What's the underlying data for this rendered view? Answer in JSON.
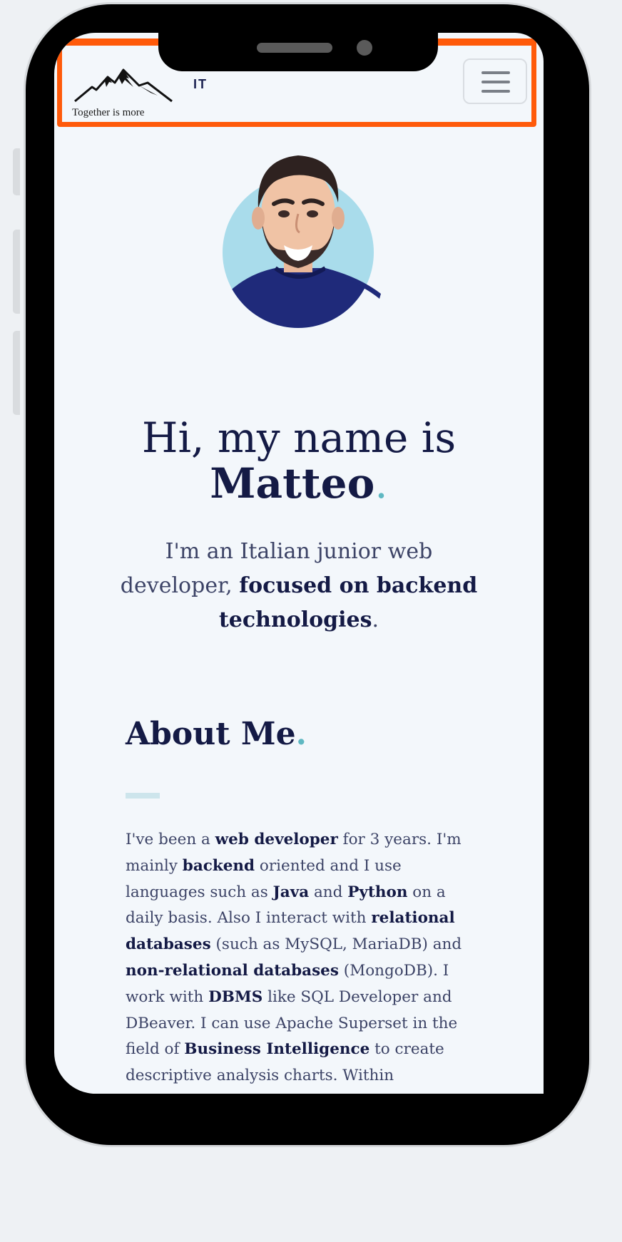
{
  "navbar": {
    "logo_tagline": "Together is more",
    "brand_suffix": "IT",
    "menu_icon": "hamburger-icon",
    "highlight_color": "#ff5a0a"
  },
  "hero": {
    "greeting": "Hi, my name is",
    "name": "Matteo",
    "period": ".",
    "subtitle_part1": "I'm an Italian junior web developer, ",
    "subtitle_bold": "focused on backend technologies",
    "subtitle_end": "."
  },
  "about": {
    "title": "About Me",
    "period": ".",
    "paragraph": [
      {
        "t": "I've been a ",
        "b": false
      },
      {
        "t": "web developer",
        "b": true
      },
      {
        "t": " for 3 years. I'm mainly ",
        "b": false
      },
      {
        "t": "backend",
        "b": true
      },
      {
        "t": " oriented and I use languages such as ",
        "b": false
      },
      {
        "t": "Java",
        "b": true
      },
      {
        "t": " and ",
        "b": false
      },
      {
        "t": "Python",
        "b": true
      },
      {
        "t": " on a daily basis. Also I interact with ",
        "b": false
      },
      {
        "t": "relational databases",
        "b": true
      },
      {
        "t": " (such as MySQL, MariaDB) and ",
        "b": false
      },
      {
        "t": "non-relational databases",
        "b": true
      },
      {
        "t": " (MongoDB). I work with ",
        "b": false
      },
      {
        "t": "DBMS",
        "b": true
      },
      {
        "t": " like SQL Developer and DBeaver. I can use Apache Superset in the field of ",
        "b": false
      },
      {
        "t": "Business Intelligence",
        "b": true
      },
      {
        "t": " to create descriptive analysis charts. Within",
        "b": false
      }
    ]
  },
  "colors": {
    "text_dark": "#141a45",
    "text_body": "#3c4366",
    "accent": "#5fb8c2",
    "background": "#f3f7fb"
  }
}
